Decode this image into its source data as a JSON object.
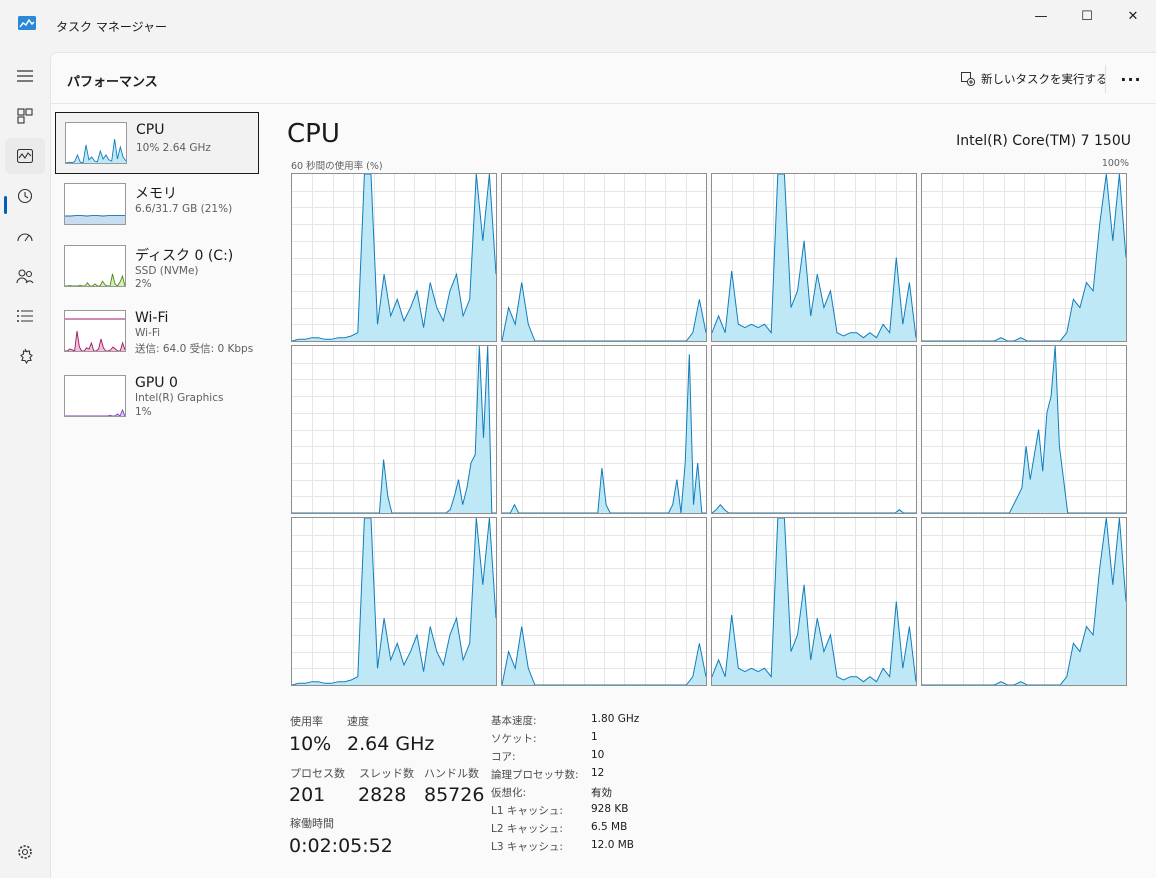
{
  "window": {
    "title": "タスク マネージャー",
    "minimize_glyph": "—",
    "maximize_glyph": "☐",
    "close_glyph": "✕"
  },
  "nav": {
    "items": [
      {
        "icon": "hamburger-menu-icon"
      },
      {
        "icon": "processes-icon"
      },
      {
        "icon": "performance-icon",
        "active": true
      },
      {
        "icon": "app-history-icon"
      },
      {
        "icon": "startup-apps-icon"
      },
      {
        "icon": "users-icon"
      },
      {
        "icon": "details-icon"
      },
      {
        "icon": "services-icon"
      },
      {
        "icon": "settings-icon"
      }
    ]
  },
  "header": {
    "title": "パフォーマンス",
    "new_task_label": "新しいタスクを実行する",
    "more_glyph": "···"
  },
  "devices": [
    {
      "name": "CPU",
      "line1": "10%  2.64 GHz",
      "color": "#117dbb",
      "fill": "#bfe8f7",
      "selected": true
    },
    {
      "name": "メモリ",
      "line1": "6.6/31.7 GB (21%)",
      "color": "#1a6ab3",
      "fill": "#c8ddf0"
    },
    {
      "name": "ディスク 0 (C:)",
      "line1": "SSD (NVMe)",
      "line2": "2%",
      "color": "#4d8a0e",
      "fill": "#d8ecc4"
    },
    {
      "name": "Wi-Fi",
      "line1": "Wi-Fi",
      "line2": "送信: 64.0  受信: 0 Kbps",
      "color": "#a01862",
      "fill": "#f0c0dc"
    },
    {
      "name": "GPU 0",
      "line1": "Intel(R) Graphics",
      "line2": "1%",
      "color": "#7b3fbf",
      "fill": "#dcc8f2"
    }
  ],
  "cpu": {
    "title": "CPU",
    "model": "Intel(R) Core(TM) 7 150U",
    "axis_label": "60 秒間の使用率 (%)",
    "axis_max": "100%",
    "line_color": "#117dbb",
    "fill_color": "#bfe8f7",
    "grid_color": "#e6e6e6"
  },
  "stats": {
    "usage_label": "使用率",
    "usage_value": "10%",
    "speed_label": "速度",
    "speed_value": "2.64 GHz",
    "processes_label": "プロセス数",
    "processes_value": "201",
    "threads_label": "スレッド数",
    "threads_value": "2828",
    "handles_label": "ハンドル数",
    "handles_value": "85726",
    "uptime_label": "稼働時間",
    "uptime_value": "0:02:05:52"
  },
  "specs": [
    {
      "label": "基本速度:",
      "value": "1.80 GHz"
    },
    {
      "label": "ソケット:",
      "value": "1"
    },
    {
      "label": "コア:",
      "value": "10"
    },
    {
      "label": "論理プロセッサ数:",
      "value": "12"
    },
    {
      "label": "仮想化:",
      "value": "有効"
    },
    {
      "label": "L1 キャッシュ:",
      "value": "928 KB"
    },
    {
      "label": "L2 キャッシュ:",
      "value": "6.5 MB"
    },
    {
      "label": "L3 キャッシュ:",
      "value": "12.0 MB"
    }
  ],
  "chart_data": {
    "type": "area",
    "x": "60 秒間",
    "ylim": [
      0,
      100
    ],
    "series": [
      {
        "values": [
          0,
          1,
          1,
          2,
          2,
          1,
          1,
          2,
          2,
          3,
          5,
          100,
          100,
          10,
          40,
          15,
          25,
          12,
          20,
          30,
          8,
          35,
          20,
          12,
          30,
          40,
          15,
          25,
          100,
          60,
          100,
          40
        ]
      },
      {
        "values": [
          0,
          20,
          10,
          35,
          10,
          0,
          0,
          0,
          0,
          0,
          0,
          0,
          0,
          0,
          0,
          0,
          0,
          0,
          0,
          0,
          0,
          0,
          0,
          0,
          0,
          0,
          0,
          0,
          0,
          5,
          25,
          5
        ]
      },
      {
        "values": [
          5,
          15,
          5,
          42,
          10,
          8,
          10,
          8,
          10,
          5,
          100,
          100,
          20,
          30,
          60,
          15,
          40,
          20,
          30,
          5,
          3,
          5,
          5,
          2,
          5,
          2,
          10,
          5,
          50,
          10,
          35,
          2
        ]
      },
      {
        "values": [
          0,
          0,
          0,
          0,
          0,
          0,
          0,
          0,
          0,
          0,
          0,
          0,
          2,
          0,
          0,
          2,
          0,
          0,
          0,
          0,
          0,
          0,
          5,
          25,
          20,
          35,
          30,
          70,
          100,
          60,
          100,
          50
        ]
      },
      {
        "values": [
          0,
          0,
          0,
          0,
          0,
          0,
          0,
          0,
          0,
          0,
          0,
          0,
          0,
          0,
          0,
          0,
          0,
          0,
          0,
          0,
          0,
          0,
          32,
          10,
          0,
          0,
          0,
          0,
          0,
          0,
          0,
          0,
          0,
          0,
          0,
          0,
          0,
          0,
          2,
          10,
          20,
          5,
          15,
          30,
          35,
          100,
          45,
          100,
          0,
          0
        ]
      },
      {
        "values": [
          0,
          0,
          0,
          5,
          0,
          0,
          0,
          0,
          0,
          0,
          0,
          0,
          0,
          0,
          0,
          0,
          0,
          0,
          0,
          0,
          0,
          0,
          0,
          0,
          27,
          5,
          0,
          0,
          0,
          0,
          0,
          0,
          0,
          0,
          0,
          0,
          0,
          0,
          0,
          0,
          0,
          5,
          20,
          0,
          30,
          95,
          5,
          30,
          0,
          0
        ]
      },
      {
        "values": [
          0,
          2,
          5,
          2,
          0,
          0,
          0,
          0,
          0,
          0,
          0,
          0,
          0,
          0,
          0,
          0,
          0,
          0,
          0,
          0,
          0,
          0,
          0,
          0,
          0,
          0,
          0,
          0,
          0,
          0,
          0,
          0,
          0,
          0,
          0,
          0,
          0,
          0,
          0,
          0,
          0,
          0,
          0,
          0,
          0,
          2,
          0,
          0,
          0,
          0
        ]
      },
      {
        "values": [
          0,
          0,
          0,
          0,
          0,
          0,
          0,
          0,
          0,
          0,
          0,
          0,
          0,
          0,
          0,
          0,
          0,
          0,
          0,
          0,
          0,
          0,
          5,
          10,
          15,
          40,
          20,
          35,
          50,
          25,
          60,
          70,
          100,
          40,
          20,
          0,
          0,
          0,
          0,
          0,
          0,
          0,
          0,
          0,
          0,
          0,
          0,
          0,
          0,
          0
        ]
      }
    ]
  }
}
